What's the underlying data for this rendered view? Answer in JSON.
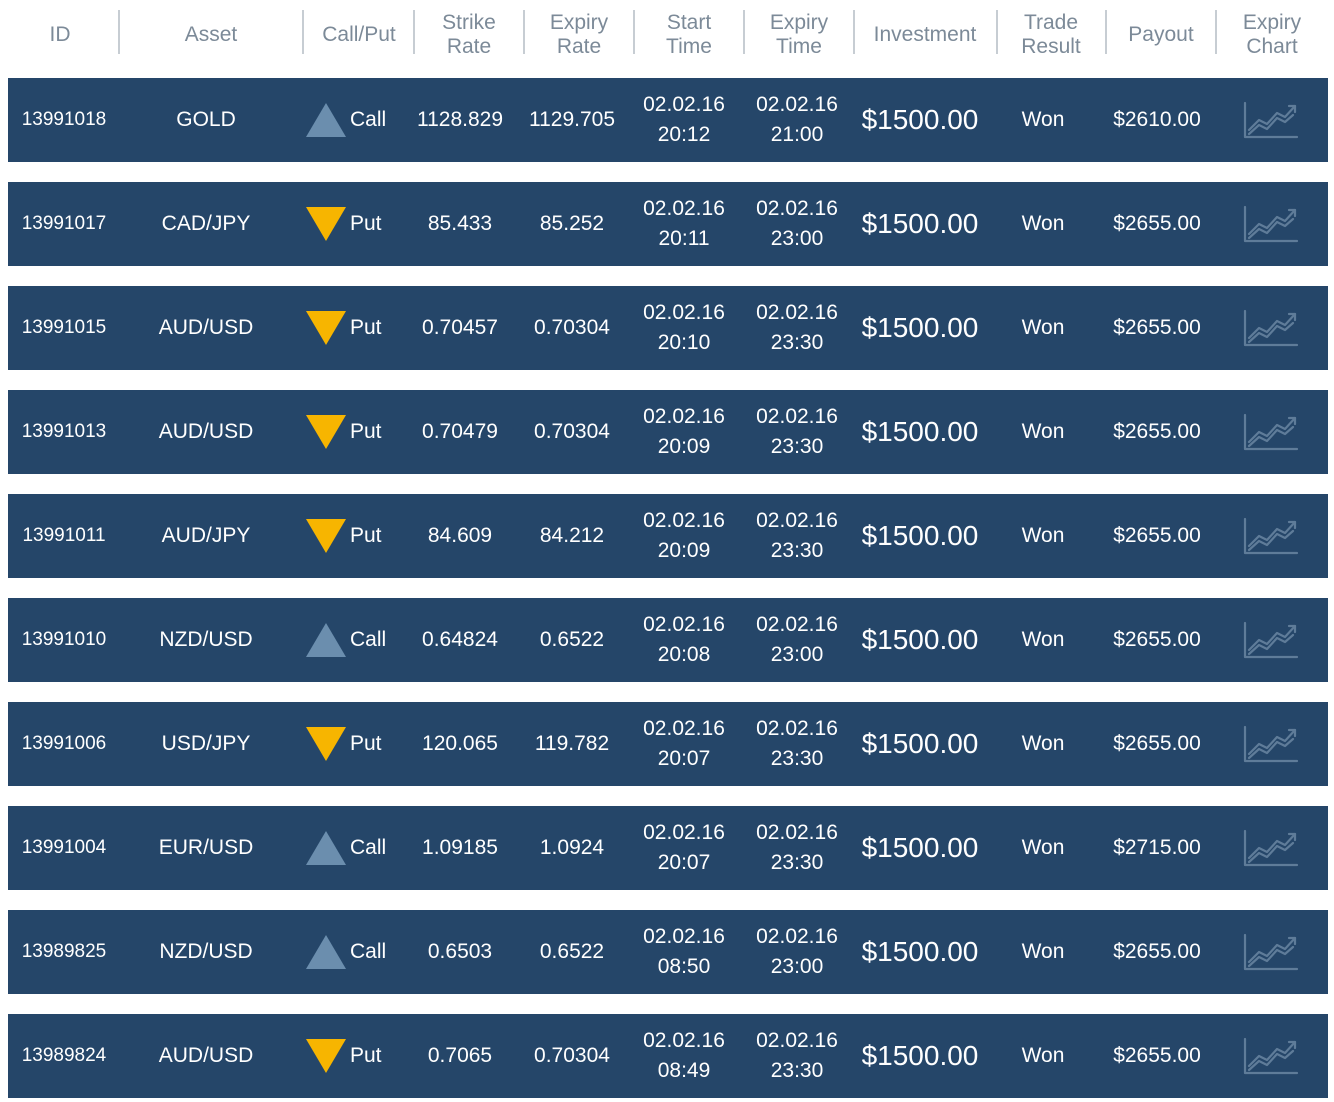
{
  "headers": [
    "ID",
    "Asset",
    "Call/Put",
    "Strike Rate",
    "Expiry Rate",
    "Start Time",
    "Expiry Time",
    "Investment",
    "Trade Result",
    "Payout",
    "Expiry Chart"
  ],
  "header_lines": {
    "id": [
      "ID"
    ],
    "asset": [
      "Asset"
    ],
    "dir": [
      "Call/Put"
    ],
    "strike": [
      "Strike",
      "Rate"
    ],
    "exprate": [
      "Expiry",
      "Rate"
    ],
    "start": [
      "Start",
      "Time"
    ],
    "exptime": [
      "Expiry",
      "Time"
    ],
    "inv": [
      "Investment"
    ],
    "res": [
      "Trade",
      "Result"
    ],
    "pay": [
      "Payout"
    ],
    "chart": [
      "Expiry",
      "Chart"
    ]
  },
  "colors": {
    "row_bg": "#254669",
    "call_triangle": "#6b8eae",
    "put_triangle": "#f7b500",
    "chart_icon": "#5f7c99",
    "header_text": "#7c8a98"
  },
  "rows": [
    {
      "id": "13991018",
      "asset": "GOLD",
      "direction": "Call",
      "strike": "1128.829",
      "expiry_rate": "1129.705",
      "start_date": "02.02.16",
      "start_time": "20:12",
      "expiry_date": "02.02.16",
      "expiry_time": "21:00",
      "investment": "$1500.00",
      "result": "Won",
      "payout": "$2610.00"
    },
    {
      "id": "13991017",
      "asset": "CAD/JPY",
      "direction": "Put",
      "strike": "85.433",
      "expiry_rate": "85.252",
      "start_date": "02.02.16",
      "start_time": "20:11",
      "expiry_date": "02.02.16",
      "expiry_time": "23:00",
      "investment": "$1500.00",
      "result": "Won",
      "payout": "$2655.00"
    },
    {
      "id": "13991015",
      "asset": "AUD/USD",
      "direction": "Put",
      "strike": "0.70457",
      "expiry_rate": "0.70304",
      "start_date": "02.02.16",
      "start_time": "20:10",
      "expiry_date": "02.02.16",
      "expiry_time": "23:30",
      "investment": "$1500.00",
      "result": "Won",
      "payout": "$2655.00"
    },
    {
      "id": "13991013",
      "asset": "AUD/USD",
      "direction": "Put",
      "strike": "0.70479",
      "expiry_rate": "0.70304",
      "start_date": "02.02.16",
      "start_time": "20:09",
      "expiry_date": "02.02.16",
      "expiry_time": "23:30",
      "investment": "$1500.00",
      "result": "Won",
      "payout": "$2655.00"
    },
    {
      "id": "13991011",
      "asset": "AUD/JPY",
      "direction": "Put",
      "strike": "84.609",
      "expiry_rate": "84.212",
      "start_date": "02.02.16",
      "start_time": "20:09",
      "expiry_date": "02.02.16",
      "expiry_time": "23:30",
      "investment": "$1500.00",
      "result": "Won",
      "payout": "$2655.00"
    },
    {
      "id": "13991010",
      "asset": "NZD/USD",
      "direction": "Call",
      "strike": "0.64824",
      "expiry_rate": "0.6522",
      "start_date": "02.02.16",
      "start_time": "20:08",
      "expiry_date": "02.02.16",
      "expiry_time": "23:00",
      "investment": "$1500.00",
      "result": "Won",
      "payout": "$2655.00"
    },
    {
      "id": "13991006",
      "asset": "USD/JPY",
      "direction": "Put",
      "strike": "120.065",
      "expiry_rate": "119.782",
      "start_date": "02.02.16",
      "start_time": "20:07",
      "expiry_date": "02.02.16",
      "expiry_time": "23:30",
      "investment": "$1500.00",
      "result": "Won",
      "payout": "$2655.00"
    },
    {
      "id": "13991004",
      "asset": "EUR/USD",
      "direction": "Call",
      "strike": "1.09185",
      "expiry_rate": "1.0924",
      "start_date": "02.02.16",
      "start_time": "20:07",
      "expiry_date": "02.02.16",
      "expiry_time": "23:30",
      "investment": "$1500.00",
      "result": "Won",
      "payout": "$2715.00"
    },
    {
      "id": "13989825",
      "asset": "NZD/USD",
      "direction": "Call",
      "strike": "0.6503",
      "expiry_rate": "0.6522",
      "start_date": "02.02.16",
      "start_time": "08:50",
      "expiry_date": "02.02.16",
      "expiry_time": "23:00",
      "investment": "$1500.00",
      "result": "Won",
      "payout": "$2655.00"
    },
    {
      "id": "13989824",
      "asset": "AUD/USD",
      "direction": "Put",
      "strike": "0.7065",
      "expiry_rate": "0.70304",
      "start_date": "02.02.16",
      "start_time": "08:49",
      "expiry_date": "02.02.16",
      "expiry_time": "23:30",
      "investment": "$1500.00",
      "result": "Won",
      "payout": "$2655.00"
    }
  ]
}
